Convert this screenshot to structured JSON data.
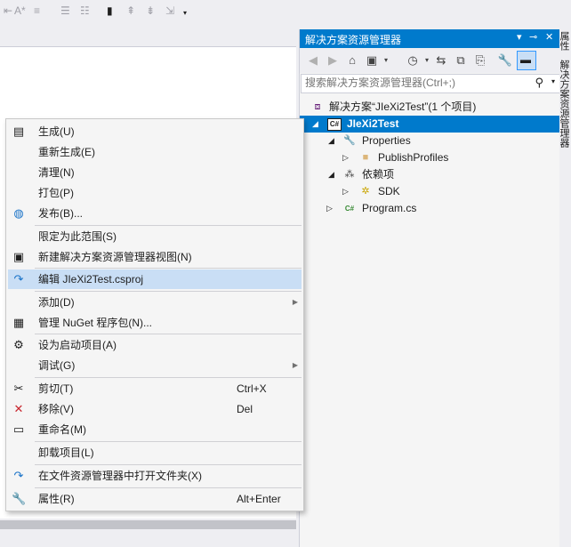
{
  "solution_explorer": {
    "title": "解决方案资源管理器",
    "pin_glyph": "▾ ⊸",
    "close_glyph": "✕",
    "search_placeholder": "搜索解决方案资源管理器(Ctrl+;)",
    "tree": [
      {
        "label": "解决方案“JIeXi2Test”(1 个项目)",
        "icon": "solution-icon"
      },
      {
        "label": "JIeXi2Test",
        "icon": "csharp-project-icon",
        "selected": true
      },
      {
        "label": "Properties",
        "icon": "wrench-icon"
      },
      {
        "label": "PublishProfiles",
        "icon": "folder-icon"
      },
      {
        "label": "依赖项",
        "icon": "dependencies-icon"
      },
      {
        "label": "SDK",
        "icon": "sdk-icon"
      },
      {
        "label": "Program.cs",
        "icon": "csharp-file-icon"
      }
    ]
  },
  "side_tabs": [
    "属性",
    "解决方案资源管理器"
  ],
  "context_menu": {
    "items": [
      {
        "label": "生成(U)",
        "icon": "build-icon"
      },
      {
        "label": "重新生成(E)"
      },
      {
        "label": "清理(N)"
      },
      {
        "label": "打包(P)"
      },
      {
        "label": "发布(B)...",
        "icon": "globe-icon"
      },
      {
        "label": "限定为此范围(S)"
      },
      {
        "label": "新建解决方案资源管理器视图(N)",
        "icon": "new-view-icon"
      },
      {
        "label": "编辑 JIeXi2Test.csproj",
        "icon": "edit-icon",
        "highlighted": true
      },
      {
        "label": "添加(D)",
        "submenu": true
      },
      {
        "label": "管理 NuGet 程序包(N)...",
        "icon": "nuget-icon"
      },
      {
        "label": "设为启动项目(A)",
        "icon": "gear-icon"
      },
      {
        "label": "调试(G)",
        "submenu": true
      },
      {
        "label": "剪切(T)",
        "icon": "scissors-icon",
        "shortcut": "Ctrl+X"
      },
      {
        "label": "移除(V)",
        "icon": "remove-icon",
        "shortcut": "Del"
      },
      {
        "label": "重命名(M)",
        "icon": "rename-icon"
      },
      {
        "label": "卸载项目(L)"
      },
      {
        "label": "在文件资源管理器中打开文件夹(X)",
        "icon": "open-folder-icon"
      },
      {
        "label": "属性(R)",
        "icon": "wrench-icon",
        "shortcut": "Alt+Enter"
      }
    ]
  },
  "colors": {
    "accent": "#007acc",
    "highlight": "#c9def5",
    "remove_red": "#c8262e"
  }
}
